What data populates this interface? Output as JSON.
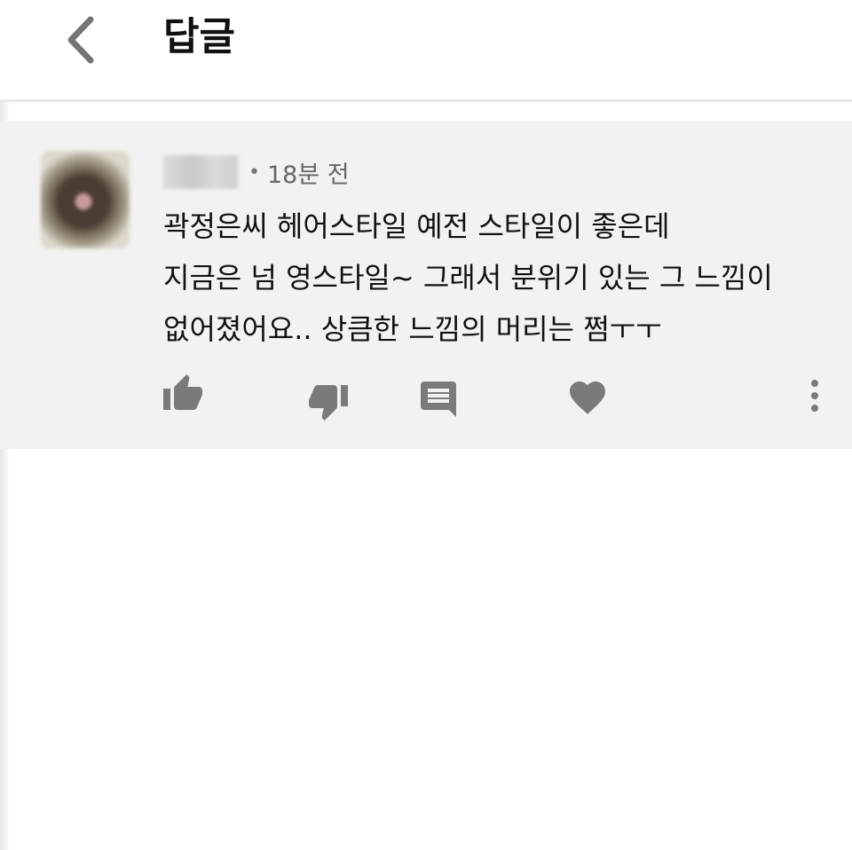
{
  "header": {
    "title": "답글",
    "back_icon": "chevron-left-icon"
  },
  "comment": {
    "author": "",
    "timestamp": "18분 전",
    "lines": [
      "곽정은씨 헤어스타일 예전 스타일이 좋은데",
      "지금은 넘 영스타일~ 그래서 분위기 있는 그 느낌이",
      "없어졌어요.. 상큼한 느낌의 머리는 쩜ㅜㅜ"
    ],
    "actions": [
      {
        "icon": "thumbs-up-icon"
      },
      {
        "icon": "thumbs-down-icon"
      },
      {
        "icon": "comment-icon"
      },
      {
        "icon": "heart-icon"
      },
      {
        "icon": "more-vertical-icon"
      }
    ]
  },
  "colors": {
    "card_background": "#f2f2f2",
    "icon_gray": "#7a7a7a",
    "text": "#111111",
    "meta_text": "#666666"
  }
}
